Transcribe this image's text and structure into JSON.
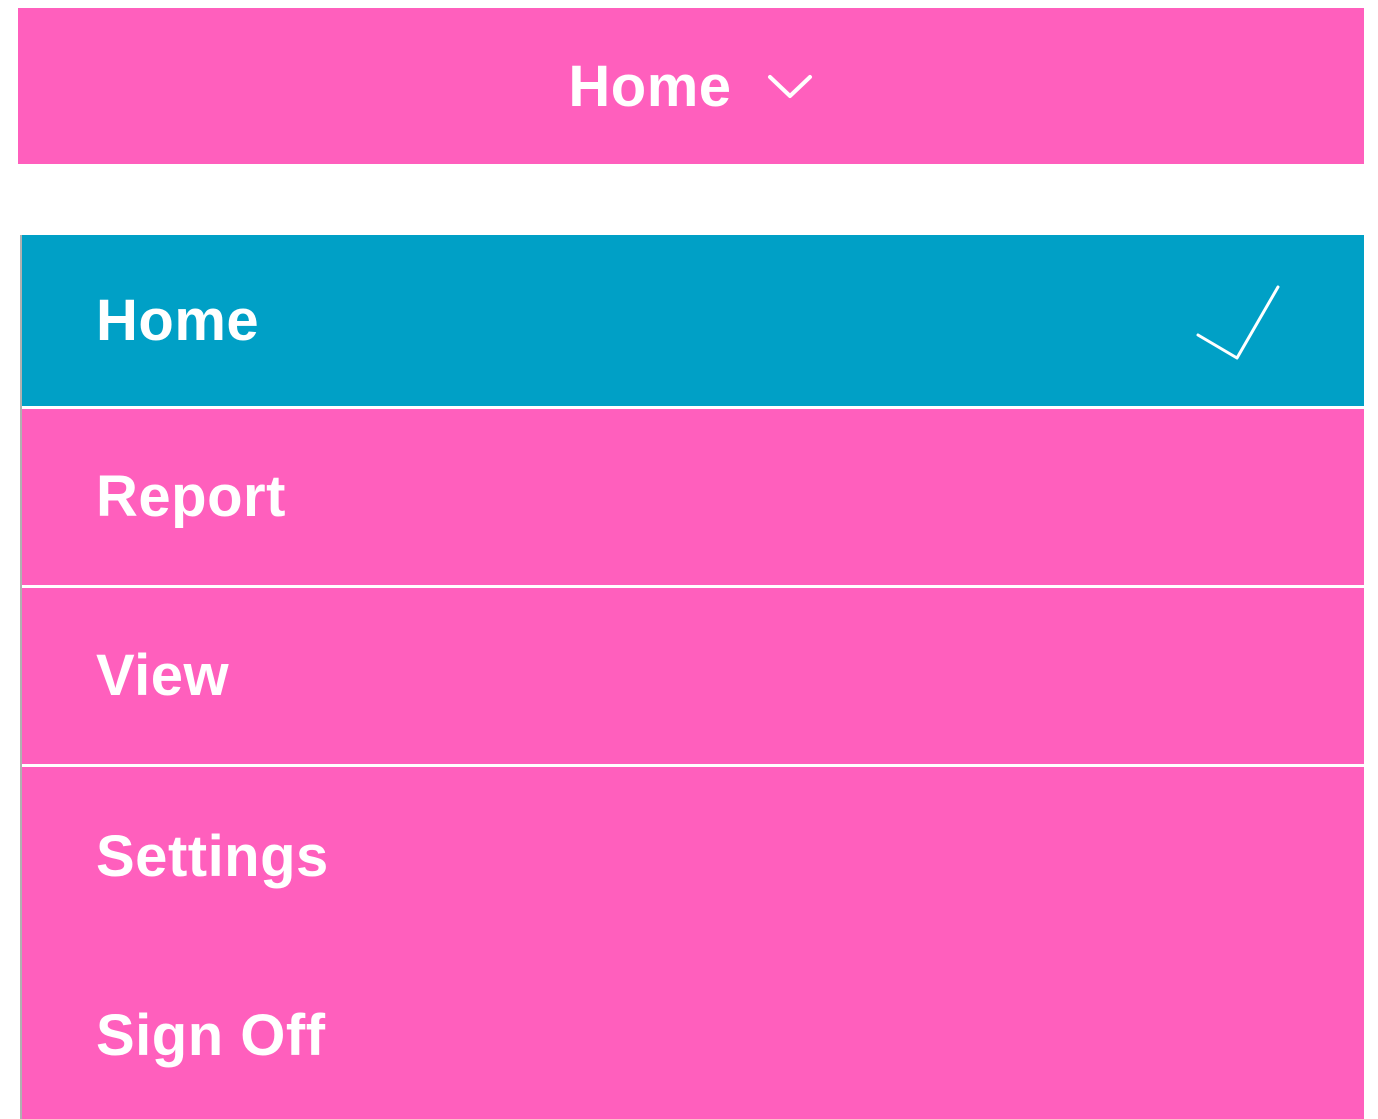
{
  "header": {
    "title": "Home",
    "chevron_icon": "chevron-down-icon"
  },
  "menu": {
    "items": [
      {
        "label": "Home",
        "selected": true,
        "icon": "checkmark-icon"
      },
      {
        "label": "Report",
        "selected": false
      },
      {
        "label": "View",
        "selected": false
      },
      {
        "label": "Settings",
        "selected": false
      },
      {
        "label": "Sign Off",
        "selected": false
      }
    ]
  },
  "colors": {
    "primary_pink": "#ff5fbd",
    "selected_blue": "#00a0c6",
    "text": "#ffffff",
    "background": "#ffffff"
  }
}
